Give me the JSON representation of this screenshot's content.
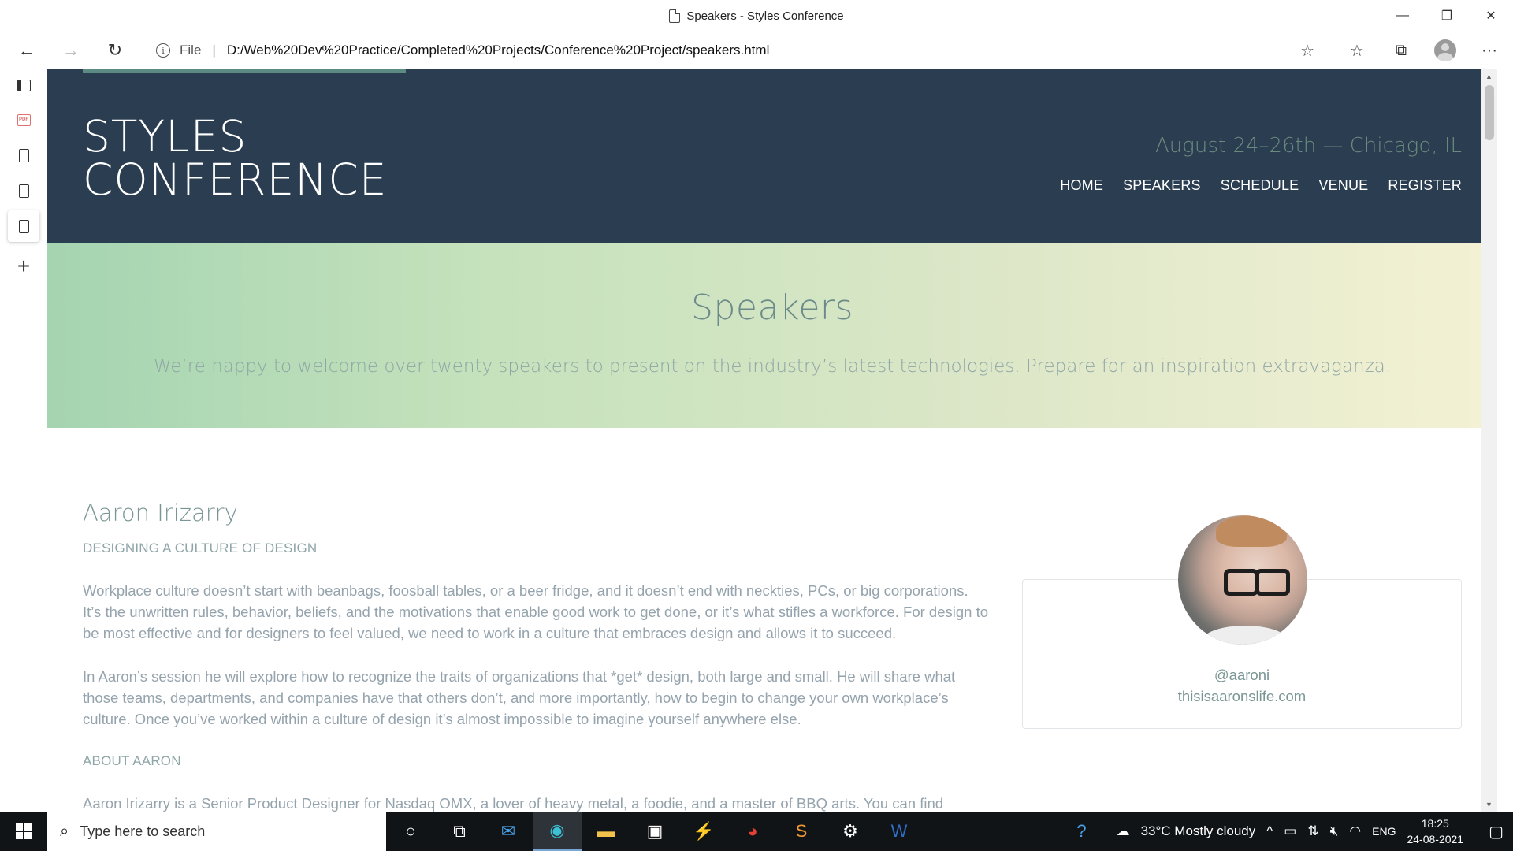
{
  "window": {
    "title": "Speakers - Styles Conference",
    "minimize": "—",
    "restore": "❐",
    "close": "✕"
  },
  "browser": {
    "back": "←",
    "forward": "→",
    "reload": "↻",
    "scheme": "File",
    "separator": "|",
    "url": "D:/Web%20Dev%20Practice/Completed%20Projects/Conference%20Project/speakers.html",
    "favorites_add_icon": "☆",
    "favorites_icon": "☆",
    "collections_icon": "⧉",
    "menu": "···"
  },
  "sidebar": {
    "add_tab": "+"
  },
  "site": {
    "logo_line1": "STYLES",
    "logo_line2": "CONFERENCE",
    "dates": "August 24–26th — Chicago, IL",
    "nav": [
      "HOME",
      "SPEAKERS",
      "SCHEDULE",
      "VENUE",
      "REGISTER"
    ],
    "hero_title": "Speakers",
    "hero_subtitle": "We’re happy to welcome over twenty speakers to present on the industry’s latest technologies. Prepare for an inspiration extravaganza.",
    "speaker": {
      "name": "Aaron Irizarry",
      "talk_title": "DESIGNING A CULTURE OF DESIGN",
      "para1": "Workplace culture doesn’t start with beanbags, foosball tables, or a beer fridge, and it doesn’t end with neckties, PCs, or big corporations. It’s the unwritten rules, behavior, beliefs, and the motivations that enable good work to get done, or it’s what stifles a workforce. For design to be most effective and for designers to feel valued, we need to work in a culture that embraces design and allows it to succeed.",
      "para2": "In Aaron’s session he will explore how to recognize the traits of organizations that *get* design, both large and small. He will share what those teams, departments, and companies have that others don’t, and more importantly, how to begin to change your own workplace’s culture. Once you’ve worked within a culture of design it’s almost impossible to imagine yourself anywhere else.",
      "about_title": "ABOUT AARON",
      "about_text": "Aaron Irizarry is a Senior Product Designer for Nasdaq OMX, a lover of heavy metal, a foodie, and a master of BBQ arts. You can find",
      "handle": "@aaroni",
      "website": "thisisaaronslife.com"
    }
  },
  "taskbar": {
    "search_placeholder": "Type here to search",
    "weather": "33°C  Mostly cloudy",
    "language": "ENG",
    "time": "18:25",
    "date": "24-08-2021"
  }
}
